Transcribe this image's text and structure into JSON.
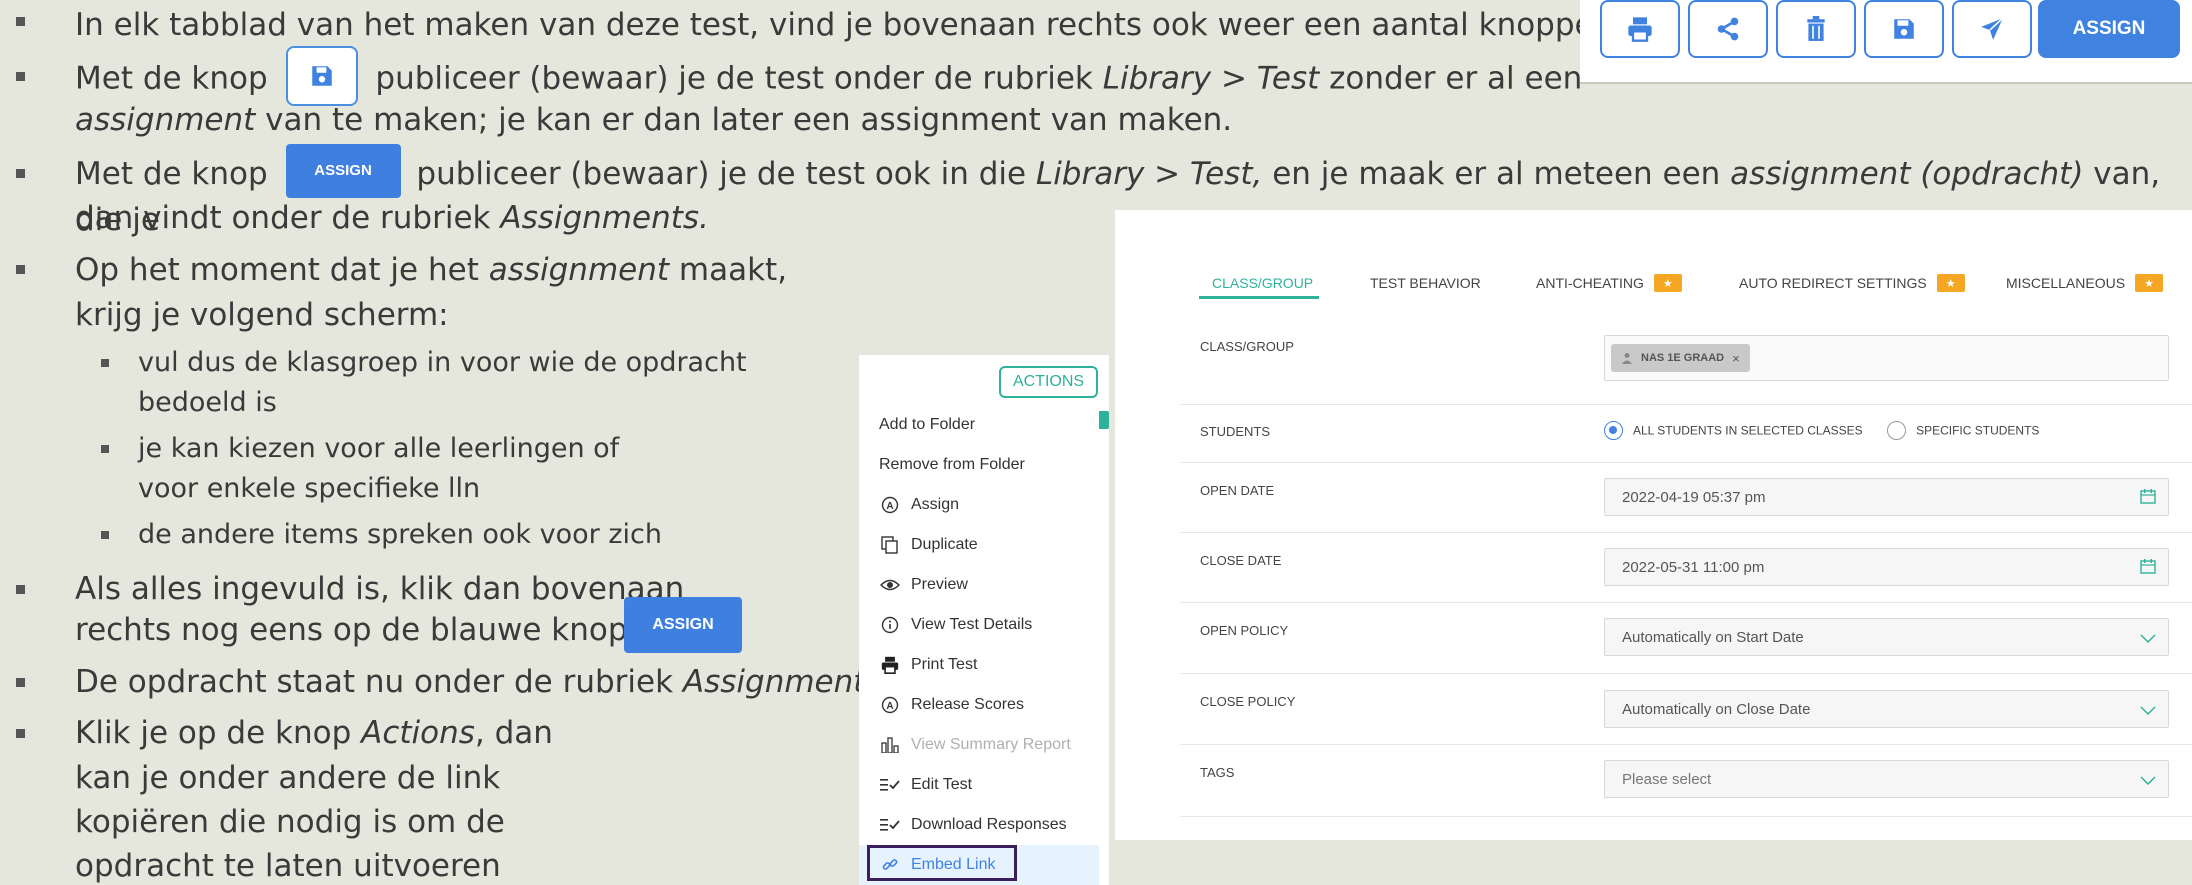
{
  "slide": {
    "line1": "In elk tabblad van het maken van deze test, vind je bovenaan rechts ook weer een aantal knoppen:",
    "line2_pre": "Met de knop",
    "line2_post": "publiceer (bewaar) je de test onder de rubriek",
    "line2_em": "Library > Test",
    "line2_end": "zonder er al een",
    "line3_em": "assignment",
    "line3_end": "van te maken; je kan er dan later een assignment van maken.",
    "line4_pre": "Met de knop",
    "line4_post": "publiceer (bewaar) je de test ook in die",
    "line4_em": "Library > Test,",
    "line4_mid": "en je maak er al meteen een",
    "line4_em2": "assignment (opdracht)",
    "line4_end": "van, die je",
    "line5_pre": "dan vindt onder de rubriek",
    "line5_em": "Assignments.",
    "line6_pre": "Op het moment dat je het",
    "line6_em": "assignment",
    "line6_end": "maakt,",
    "line7": "krijg je volgend scherm:",
    "sub1a": "vul dus de klasgroep in voor wie de opdracht",
    "sub1b": "bedoeld is",
    "sub2a": "je kan kiezen voor alle leerlingen of",
    "sub2b": "voor enkele specifieke lln",
    "sub3": "de andere items spreken ook voor zich",
    "line8": "Als alles ingevuld is, klik dan bovenaan",
    "line9": "rechts nog eens op de blauwe knop",
    "line10_pre": "De opdracht staat nu onder de rubriek",
    "line10_em": "Assignments",
    "line11_pre": "Klik je op de knop",
    "line11_em": "Actions",
    "line11_end": ", dan",
    "line12": "kan je onder andere de link",
    "line13": "kopiëren die nodig is om de",
    "line14": "opdracht te laten uitvoeren",
    "inline_assign": "ASSIGN"
  },
  "toolbar": {
    "buttons": [
      "print-icon",
      "share-icon",
      "trash-icon",
      "save-icon",
      "send-icon"
    ],
    "assign_label": "ASSIGN"
  },
  "actions": {
    "header_label": "ACTIONS",
    "items": [
      {
        "label": "Add to Folder",
        "icon": "none"
      },
      {
        "label": "Remove from Folder",
        "icon": "none"
      },
      {
        "label": "Assign",
        "icon": "circle-a-icon"
      },
      {
        "label": "Duplicate",
        "icon": "duplicate-icon"
      },
      {
        "label": "Preview",
        "icon": "eye-icon"
      },
      {
        "label": "View Test Details",
        "icon": "info-icon"
      },
      {
        "label": "Print Test",
        "icon": "print-icon"
      },
      {
        "label": "Release Scores",
        "icon": "circle-a-icon"
      },
      {
        "label": "View Summary Report",
        "icon": "bar-chart-icon",
        "disabled": true
      },
      {
        "label": "Edit Test",
        "icon": "list-check-icon"
      },
      {
        "label": "Download Responses",
        "icon": "list-check-icon"
      },
      {
        "label": "Embed Link",
        "icon": "link-icon",
        "highlighted": true
      }
    ]
  },
  "settings": {
    "tabs": [
      {
        "label": "CLASS/GROUP",
        "active": true,
        "star": false
      },
      {
        "label": "TEST BEHAVIOR",
        "active": false,
        "star": false
      },
      {
        "label": "ANTI-CHEATING",
        "active": false,
        "star": true
      },
      {
        "label": "AUTO REDIRECT SETTINGS",
        "active": false,
        "star": true
      },
      {
        "label": "MISCELLANEOUS",
        "active": false,
        "star": true
      }
    ],
    "class_group_label": "CLASS/GROUP",
    "class_group_chip": "NAS 1E GRAAD",
    "students_label": "STUDENTS",
    "students_option1": "ALL STUDENTS IN SELECTED CLASSES",
    "students_option2": "SPECIFIC STUDENTS",
    "open_date_label": "OPEN DATE",
    "open_date_value": "2022-04-19 05:37 pm",
    "close_date_label": "CLOSE DATE",
    "close_date_value": "2022-05-31 11:00 pm",
    "open_policy_label": "OPEN POLICY",
    "open_policy_value": "Automatically on Start Date",
    "close_policy_label": "CLOSE POLICY",
    "close_policy_value": "Automatically on Close Date",
    "tags_label": "TAGS",
    "tags_placeholder": "Please select"
  },
  "colors": {
    "accent_blue": "#3f82e0",
    "accent_teal": "#2fb29a",
    "star_orange": "#f5a623",
    "background": "#e6e7dc"
  }
}
